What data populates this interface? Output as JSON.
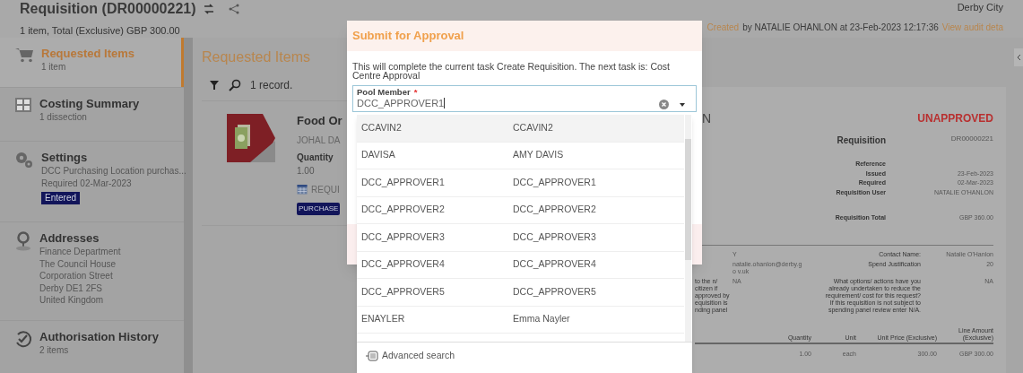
{
  "header": {
    "title": "Requisition (DR00000221)",
    "summary": "1 item, Total (Exclusive) GBP 300.00",
    "org": "Derby City",
    "audit": {
      "created": "Created",
      "text": "by NATALIE OHANLON at 23-Feb-2023 12:17:36",
      "link": "View audit deta"
    }
  },
  "sidebar": {
    "items": [
      {
        "title": "Requested Items",
        "lines": [
          "1 item"
        ],
        "selected": true
      },
      {
        "title": "Costing Summary",
        "lines": [
          "1 dissection"
        ],
        "selected": false
      },
      {
        "title": "Settings",
        "lines": [
          "DCC Purchasing Location purchas...",
          "Required 02-Mar-2023"
        ],
        "badge": "Entered",
        "selected": false
      },
      {
        "title": "Addresses",
        "lines": [
          "Finance Department",
          "The Council House",
          "Corporation Street",
          "Derby DE1 2FS",
          "United Kingdom"
        ],
        "selected": false
      },
      {
        "title": "Authorisation History",
        "lines": [
          "2 items"
        ],
        "selected": false
      }
    ]
  },
  "main": {
    "title": "Requested Items",
    "record_count": "1 record.",
    "item": {
      "title": "Food Or",
      "supplier": "JOHAL DA",
      "quantity_label": "Quantity",
      "quantity": "1.00",
      "requisition": "REQUI",
      "tag": "PURCHASE"
    }
  },
  "document": {
    "title_fragment": "N",
    "status": "UNAPPROVED",
    "fields": [
      {
        "label": "Requisition",
        "value": "DR00000221"
      },
      {
        "label": "Reference"
      },
      {
        "label": "Issued",
        "value": "23-Feb-2023"
      },
      {
        "label": "Required",
        "value": "02-Mar-2023"
      },
      {
        "label": "Requisition User",
        "value": "NATALIE O'HANLON"
      },
      {
        "label": "Requisition Total",
        "value": "GBP 360.00"
      }
    ],
    "details": [
      {
        "value_left": "Y",
        "label": "Contact Name:",
        "value": "Natalie O'Hanlon"
      },
      {
        "value_left": "natalie.ohanlon@derby.go v.uk",
        "label": "Spend Justification",
        "value": "20"
      },
      {
        "text_left": "to the n/ citizen if approved by equisition is nding panel",
        "value_left": "NA",
        "label": "What options/ actions have you already undertaken to reduce the requirement/ cost for this request? If this requisition is not subject to spending panel review enter N/A.",
        "value": "NA"
      }
    ],
    "table": {
      "columns": [
        "Quantity",
        "Unit",
        "Unit Price (Exclusive)",
        "Line Amount (Exclusive)"
      ],
      "row": [
        "1.00",
        "each",
        "300.00",
        "GBP 300.00"
      ]
    }
  },
  "dialog": {
    "title": "Submit for Approval",
    "message": "This will complete the current task Create Requisition. The next task is: Cost Centre Approval",
    "field": {
      "label": "Pool Member",
      "marker": "*",
      "value": "DCC_APPROVER1"
    },
    "options": [
      {
        "code": "CCAVIN2",
        "name": "CCAVIN2",
        "highlighted": true
      },
      {
        "code": "DAVISA",
        "name": "AMY DAVIS",
        "highlighted": false
      },
      {
        "code": "DCC_APPROVER1",
        "name": "DCC_APPROVER1",
        "highlighted": false
      },
      {
        "code": "DCC_APPROVER2",
        "name": "DCC_APPROVER2",
        "highlighted": false
      },
      {
        "code": "DCC_APPROVER3",
        "name": "DCC_APPROVER3",
        "highlighted": false
      },
      {
        "code": "DCC_APPROVER4",
        "name": "DCC_APPROVER4",
        "highlighted": false
      },
      {
        "code": "DCC_APPROVER5",
        "name": "DCC_APPROVER5",
        "highlighted": false
      },
      {
        "code": "ENAYLER",
        "name": "Emma Nayler",
        "highlighted": false
      }
    ],
    "advanced_search": "Advanced search"
  }
}
